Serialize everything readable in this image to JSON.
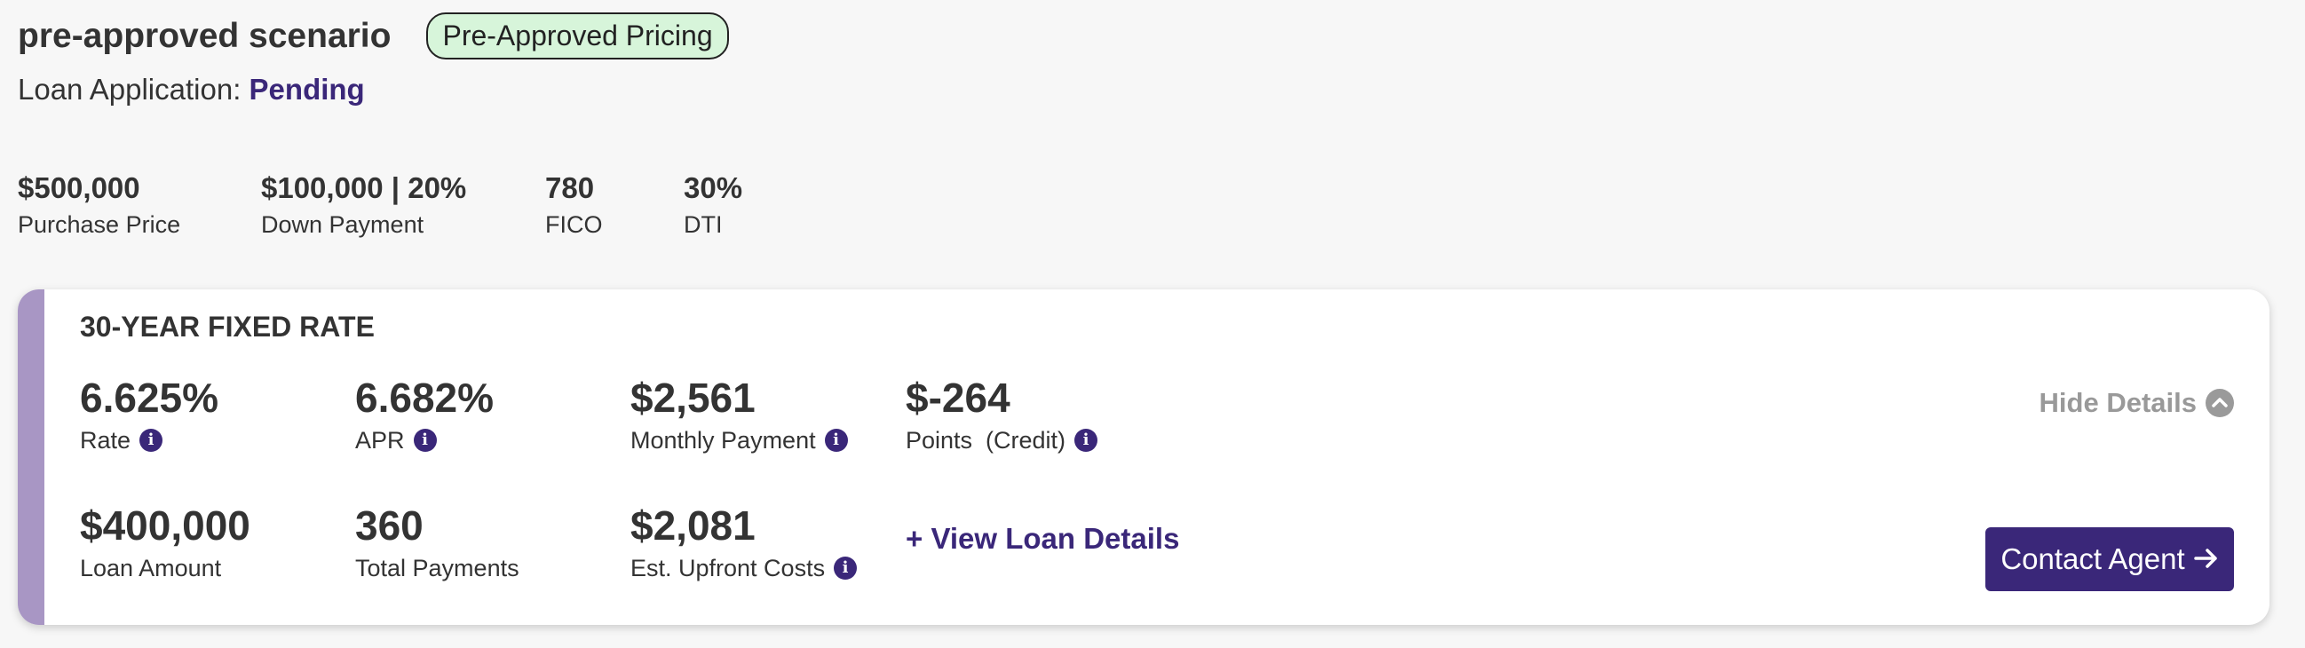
{
  "header": {
    "scenario_title": "pre-approved scenario",
    "badge": "Pre-Approved Pricing",
    "loan_application_label": "Loan Application:",
    "loan_application_status": "Pending"
  },
  "stats": [
    {
      "value": "$500,000",
      "label": "Purchase Price"
    },
    {
      "value": "$100,000 | 20%",
      "label": "Down Payment"
    },
    {
      "value": "780",
      "label": "FICO"
    },
    {
      "value": "30%",
      "label": "DTI"
    }
  ],
  "card": {
    "title": "30-YEAR FIXED RATE",
    "metrics": [
      {
        "value": "6.625%",
        "label": "Rate",
        "has_info": true
      },
      {
        "value": "6.682%",
        "label": "APR",
        "has_info": true
      },
      {
        "value": "$2,561",
        "label": "Monthly Payment",
        "has_info": true
      },
      {
        "value": "$-264",
        "label": "Points  (Credit)",
        "has_info": true
      },
      {
        "value": "$400,000",
        "label": "Loan Amount",
        "has_info": false
      },
      {
        "value": "360",
        "label": "Total Payments",
        "has_info": false
      },
      {
        "value": "$2,081",
        "label": "Est. Upfront Costs",
        "has_info": true
      }
    ],
    "hide_details_label": "Hide Details",
    "view_details_label": "+ View Loan Details",
    "contact_label": "Contact Agent"
  },
  "colors": {
    "brand_purple": "#3a2779",
    "accent_bar": "#a896c4",
    "badge_bg": "#d7f5da",
    "muted": "#999999"
  },
  "icons": {
    "info": "info-icon",
    "hide_details": "chevron-up-icon",
    "contact": "arrow-right-icon"
  }
}
